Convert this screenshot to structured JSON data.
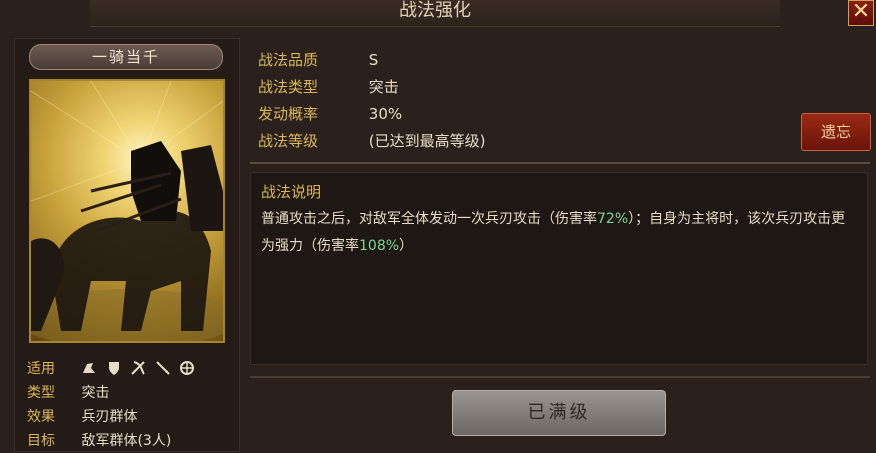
{
  "window": {
    "title": "战法强化",
    "close_label": "✕"
  },
  "skill": {
    "name": "一骑当千",
    "attributes": [
      {
        "label": "适用",
        "value": "",
        "icons": [
          "cavalry-icon",
          "shield-icon",
          "archer-icon",
          "spear-icon",
          "chariot-icon"
        ]
      },
      {
        "label": "类型",
        "value": "突击"
      },
      {
        "label": "效果",
        "value": "兵刃群体"
      },
      {
        "label": "目标",
        "value": "敌军群体(3人)"
      }
    ]
  },
  "info": {
    "quality_label": "战法品质",
    "quality_value": "S",
    "type_label": "战法类型",
    "type_value": "突击",
    "rate_label": "发动概率",
    "rate_value": "30%",
    "level_label": "战法等级",
    "level_value": "(已达到最高等级)"
  },
  "buttons": {
    "forget": "遗忘",
    "maxed": "已满级"
  },
  "description": {
    "title": "战法说明",
    "seg1": "普通攻击之后，对敌军全体发动一次兵刃攻击（伤害率",
    "seg1_value": "72%",
    "seg2": "）；自身为主将时，该次兵刃攻击更为强力（伤害率",
    "seg2_value": "108%",
    "seg3": "）"
  },
  "colors": {
    "accent_gold": "#d9b85a",
    "highlight_green": "#7ed39a",
    "forget_red": "#9a2a14"
  }
}
